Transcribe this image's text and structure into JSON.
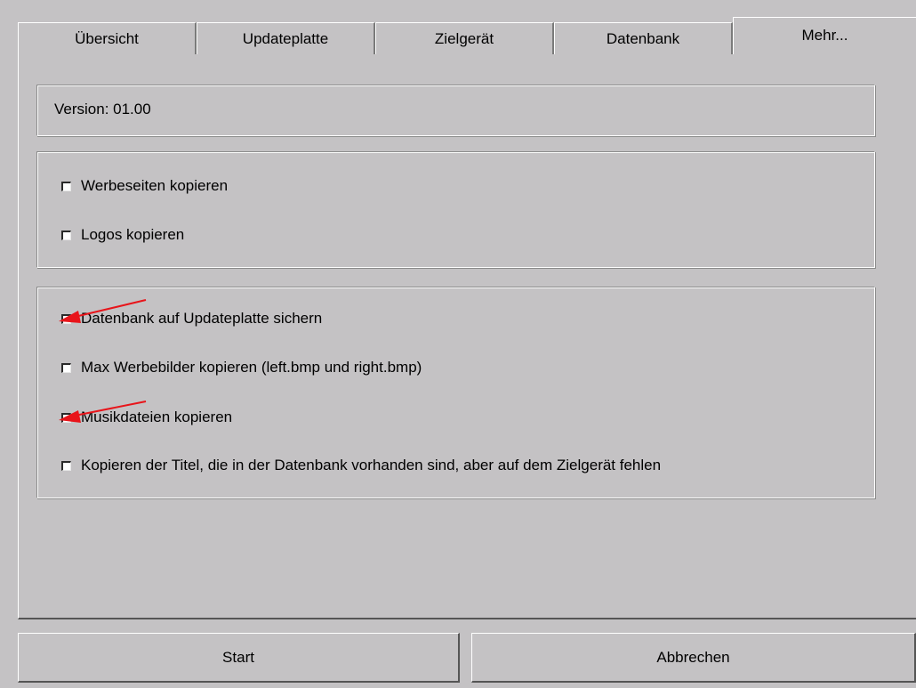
{
  "tabs": [
    {
      "label": "Übersicht"
    },
    {
      "label": "Updateplatte"
    },
    {
      "label": "Zielgerät"
    },
    {
      "label": "Datenbank"
    },
    {
      "label": "Mehr..."
    }
  ],
  "active_tab": "Mehr...",
  "version": {
    "text": "Version: 01.00"
  },
  "copy_group": {
    "options": [
      {
        "label": "Werbeseiten kopieren",
        "checked": false
      },
      {
        "label": "Logos kopieren",
        "checked": false
      }
    ]
  },
  "extra_group": {
    "options": [
      {
        "label": "Datenbank auf Updateplatte sichern",
        "checked": false
      },
      {
        "label": "Max Werbebilder kopieren (left.bmp und right.bmp)",
        "checked": false
      },
      {
        "label": "Musikdateien kopieren",
        "checked": false
      },
      {
        "label": "Kopieren der Titel, die in der Datenbank vorhanden sind, aber auf dem Zielgerät fehlen",
        "checked": false
      }
    ]
  },
  "buttons": {
    "start": "Start",
    "cancel": "Abbrechen"
  },
  "annotations": {
    "arrow_color": "#e8141a",
    "arrow_targets": [
      "Datenbank auf Updateplatte sichern",
      "Musikdateien kopieren"
    ]
  },
  "colors": {
    "window_bg": "#c4c2c4"
  }
}
